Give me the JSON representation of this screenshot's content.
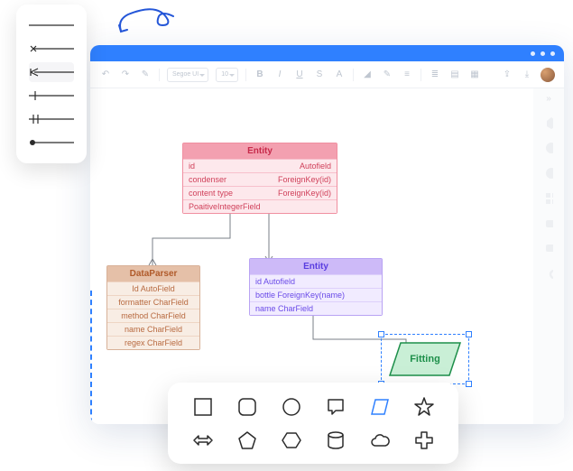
{
  "toolbar": {
    "font_family": "Segoe UI",
    "font_size": "10"
  },
  "entities": {
    "red": {
      "title": "Entity",
      "rows": [
        {
          "name": "id",
          "type": "Autofield"
        },
        {
          "name": "condenser",
          "type": "ForeignKey(id)"
        },
        {
          "name": "content type",
          "type": "ForeignKey(id)"
        },
        {
          "name": "PoaitiveIntegerField",
          "type": ""
        }
      ]
    },
    "purple": {
      "title": "Entity",
      "rows": [
        {
          "name": "id Autofield",
          "type": ""
        },
        {
          "name": "bottle ForeignKey(name)",
          "type": ""
        },
        {
          "name": "name CharField",
          "type": ""
        }
      ]
    },
    "brown": {
      "title": "DataParser",
      "rows": [
        {
          "name": "Id AutoField"
        },
        {
          "name": "formatter CharField"
        },
        {
          "name": "method CharField"
        },
        {
          "name": "name CharField"
        },
        {
          "name": "regex CharField"
        }
      ]
    }
  },
  "fitting": {
    "label": "Fitting"
  }
}
